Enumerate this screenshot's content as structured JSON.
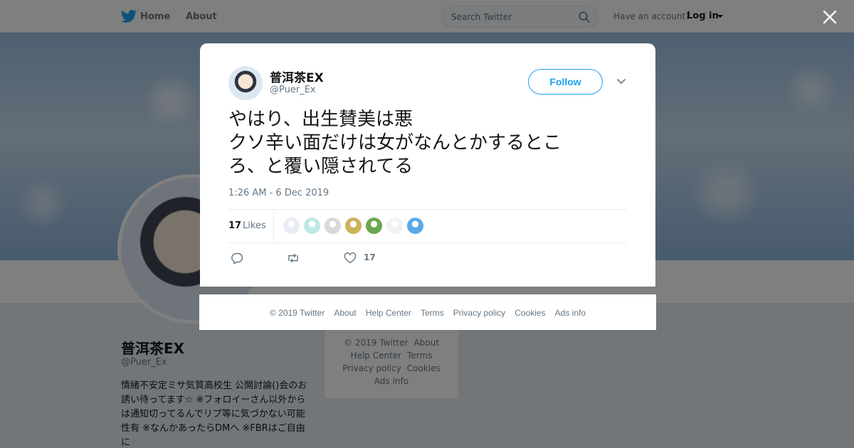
{
  "nav": {
    "home_label": "Home",
    "about_label": "About",
    "search_placeholder": "Search Twitter",
    "have_account": "Have an account?",
    "login_label": "Log in"
  },
  "profile": {
    "name": "普洱茶EX",
    "handle": "@Puer_Ex",
    "bio": "情緒不安定ミサ気質高校生 公開討論()会のお誘い待ってます☆ ※フォロイーさん以外からは通知切ってるんでリプ等に気づかない可能性有 ※なんかあったらDMへ ※FBRはご自由に"
  },
  "side_footer": {
    "copyright": "© 2019 Twitter",
    "about": "About",
    "help": "Help Center",
    "terms": "Terms",
    "privacy": "Privacy policy",
    "cookies": "Cookies",
    "ads": "Ads info"
  },
  "tweet": {
    "author_name": "普洱茶EX",
    "author_handle": "@Puer_Ex",
    "follow_label": "Follow",
    "text_lines": [
      "やはり、出生賛美は悪",
      "クソ辛い面だけは女がなんとかするとこ",
      "ろ、と覆い隠されてる"
    ],
    "timestamp": "1:26 AM - 6 Dec 2019",
    "likes_count": "17",
    "likes_label": "Likes",
    "action_like_count": "17",
    "liker_colors": [
      "#e8ecf6",
      "#bfe8e6",
      "#d9d9d9",
      "#c9b35a",
      "#6aa84f",
      "#f2f2f2",
      "#5aa9e6"
    ]
  },
  "footer": {
    "copyright": "© 2019 Twitter",
    "about": "About",
    "help": "Help Center",
    "terms": "Terms",
    "privacy": "Privacy policy",
    "cookies": "Cookies",
    "ads": "Ads info"
  },
  "colors": {
    "accent": "#1da1f2",
    "muted": "#657786"
  }
}
